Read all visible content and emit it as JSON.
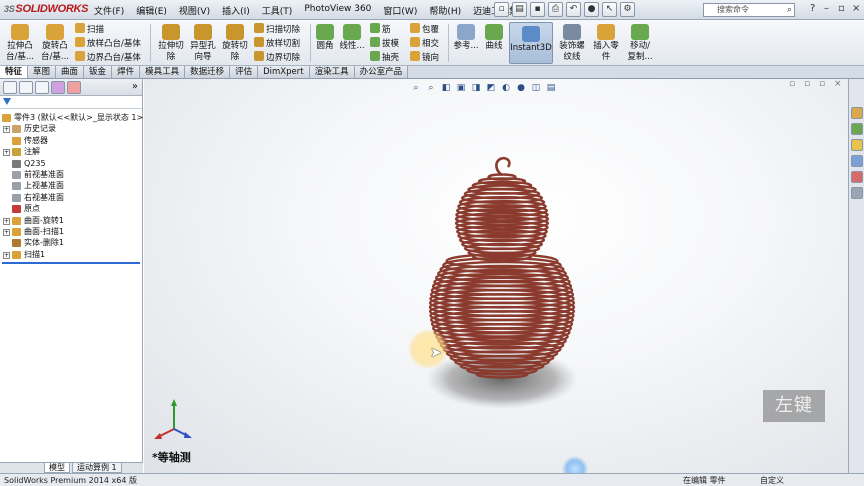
{
  "app": {
    "brand": "SOLIDWORKS"
  },
  "menu": [
    "文件(F)",
    "编辑(E)",
    "视图(V)",
    "插入(I)",
    "工具(T)",
    "PhotoView 360",
    "窗口(W)",
    "帮助(H)",
    "迈迪工具集"
  ],
  "search_placeholder": "搜索命令",
  "ribbon": {
    "features": [
      {
        "label1": "拉伸凸",
        "label2": "台/基...",
        "color": "#d9a33a"
      },
      {
        "label1": "旋转凸",
        "label2": "台/基...",
        "color": "#d9a33a"
      }
    ],
    "sweep_group": [
      "扫描",
      "放样凸台/基体",
      "边界凸台/基体"
    ],
    "cuts": [
      {
        "label1": "拉伸切",
        "label2": "除",
        "color": "#c9962e"
      },
      {
        "label1": "异型孔",
        "label2": "向导",
        "color": "#c9962e"
      },
      {
        "label1": "旋转切",
        "label2": "除",
        "color": "#c9962e"
      }
    ],
    "cut_group": [
      "扫描切除",
      "放样切割",
      "边界切除"
    ],
    "fillet": {
      "label1": "圆角",
      "label2": ""
    },
    "pattern": {
      "label1": "线性...",
      "label2": ""
    },
    "rib_group": [
      "筋",
      "拔模",
      "抽壳"
    ],
    "wrap_group": [
      "包覆",
      "相交",
      "镜向"
    ],
    "ref": {
      "label1": "参考...",
      "label2": ""
    },
    "curve": {
      "label1": "曲线",
      "label2": ""
    },
    "instant3d": "Instant3D",
    "thread": {
      "label1": "装饰螺",
      "label2": "纹线"
    },
    "insert_part": {
      "label1": "插入零",
      "label2": "件"
    },
    "move_copy": {
      "label1": "移动/",
      "label2": "复制..."
    }
  },
  "tabs": [
    "特征",
    "草图",
    "曲面",
    "钣金",
    "焊件",
    "模具工具",
    "数据迁移",
    "评估",
    "DimXpert",
    "渲染工具",
    "办公室产品"
  ],
  "active_tab": "特征",
  "tree": [
    {
      "label": "零件3  (默认<<默认>_显示状态 1>)",
      "indent": 0,
      "expand": "",
      "color": "#d9a33a"
    },
    {
      "label": "历史记录",
      "indent": 1,
      "expand": "+",
      "color": "#c9a36a"
    },
    {
      "label": "传感器",
      "indent": 1,
      "expand": "",
      "color": "#d9a33a"
    },
    {
      "label": "注解",
      "indent": 1,
      "expand": "+",
      "color": "#c9a33a"
    },
    {
      "label": "Q235",
      "indent": 1,
      "expand": "",
      "color": "#7a7a7a"
    },
    {
      "label": "前视基准面",
      "indent": 1,
      "expand": "",
      "color": "#9aa0a8"
    },
    {
      "label": "上视基准面",
      "indent": 1,
      "expand": "",
      "color": "#9aa0a8"
    },
    {
      "label": "右视基准面",
      "indent": 1,
      "expand": "",
      "color": "#9aa0a8"
    },
    {
      "label": "原点",
      "indent": 1,
      "expand": "",
      "color": "#c43a3a"
    },
    {
      "label": "曲面-旋转1",
      "indent": 1,
      "expand": "+",
      "color": "#d9a33a"
    },
    {
      "label": "曲面-扫描1",
      "indent": 1,
      "expand": "+",
      "color": "#d9a33a"
    },
    {
      "label": "实体-删除1",
      "indent": 1,
      "expand": "",
      "color": "#b07a30"
    },
    {
      "label": "扫描1",
      "indent": 1,
      "expand": "+",
      "color": "#d9a33a"
    }
  ],
  "bottom_tabs": [
    "模型",
    "运动算例 1"
  ],
  "viewport": {
    "view_label": "*等轴测",
    "key_hint": "左键",
    "model_color": "#8a3b2e"
  },
  "status": {
    "product": "SolidWorks Premium 2014 x64 版",
    "mode": "在编辑 零件",
    "units": "自定义"
  }
}
